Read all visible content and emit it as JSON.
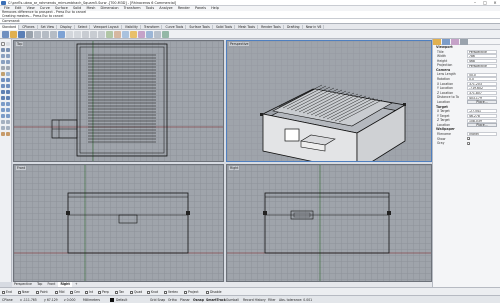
{
  "window": {
    "title": "C:\\pnrEs-ubna_ar_rohmendu_mimumbhach_Squam5.Surw -[T00.M3D] - [Rhinoceros 6 Commercial]"
  },
  "menu": [
    "File",
    "Edit",
    "View",
    "Curve",
    "Surface",
    "Solid",
    "Mesh",
    "Dimension",
    "Transform",
    "Tools",
    "Analyze",
    "Render",
    "Panels",
    "Help"
  ],
  "command_history": [
    "Removes difference to prospect - Press Esc to cancel",
    "Creating meshes... Press Esc to cancel"
  ],
  "command_prompt": "Command:",
  "tabs": [
    "Standard",
    "CPlanes",
    "Set View",
    "Display",
    "Select",
    "Viewport Layout",
    "Visibility",
    "Transform",
    "Curve Tools",
    "Surface Tools",
    "Solid Tools",
    "Mesh Tools",
    "Render Tools",
    "Drafting",
    "New in V6"
  ],
  "viewports": {
    "top": "Top",
    "perspective": "Perspective",
    "front": "Front",
    "right": "Right"
  },
  "viewport_tabs": [
    "Perspective",
    "Top",
    "Front",
    "Right",
    "+"
  ],
  "panel": {
    "section_viewport": "Viewport",
    "viewport_rows": [
      {
        "k": "Title",
        "v": "Perspective"
      },
      {
        "k": "Width",
        "v": "786"
      },
      {
        "k": "Height",
        "v": "468"
      },
      {
        "k": "Projection",
        "v": "Perspective"
      }
    ],
    "section_camera": "Camera",
    "camera_rows": [
      {
        "k": "Lens Length",
        "v": "50.0"
      },
      {
        "k": "Rotation",
        "v": "0.0"
      },
      {
        "k": "X Location",
        "v": "371.203"
      },
      {
        "k": "Y Location",
        "v": "-719.602"
      },
      {
        "k": "Z Location",
        "v": "371.807"
      },
      {
        "k": "Distance to Ta",
        "v": "403.179"
      }
    ],
    "location_button": "Place...",
    "section_target": "Target",
    "target_rows": [
      {
        "k": "X Target",
        "v": "-27.541"
      },
      {
        "k": "Y Target",
        "v": "46.278"
      },
      {
        "k": "Z Target",
        "v": "108.039"
      }
    ],
    "target_location_button": "Place...",
    "section_wallpaper": "Wallpaper",
    "wallpaper_rows": [
      {
        "k": "Filename",
        "v": "(none)"
      },
      {
        "k": "Show",
        "v": "✓"
      },
      {
        "k": "Gray",
        "v": "✓"
      }
    ]
  },
  "osnap": [
    "End",
    "Near",
    "Point",
    "Mid",
    "Cen",
    "Int",
    "Perp",
    "Tan",
    "Quad",
    "Knot",
    "Vertex",
    "Project",
    "Disable"
  ],
  "status": {
    "plane": "CPlane",
    "x": "x -111.765",
    "y": "y 67.129",
    "z": "z 0.000",
    "units": "Millimeters",
    "layer": "Default",
    "items": [
      "Grid Snap",
      "Ortho",
      "Planar",
      "Osnap",
      "SmartTrack",
      "Gumball",
      "Record History",
      "Filter",
      "Abs. tolerance: 0.001"
    ]
  },
  "colors": {
    "viewport_bg": "#9fa4ab",
    "grid": "#8d9299",
    "accent": "#4f7fbf"
  }
}
